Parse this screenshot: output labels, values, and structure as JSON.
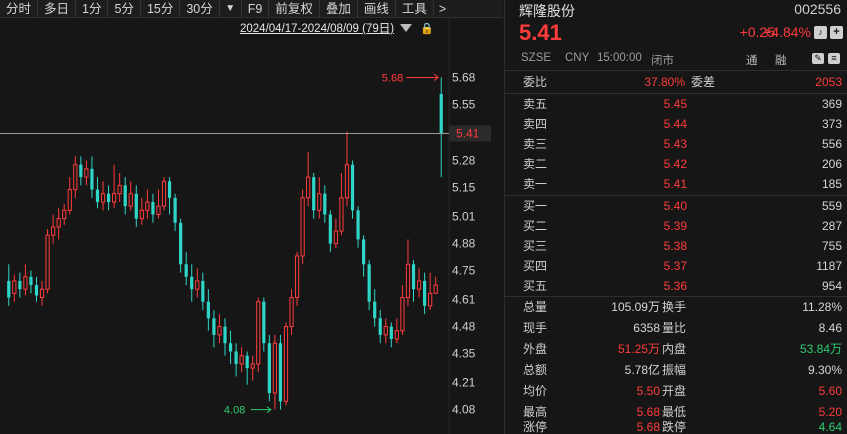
{
  "toolbar": {
    "buttons": [
      "分时",
      "多日",
      "1分",
      "5分",
      "15分",
      "30分",
      "▼",
      "F9",
      "前复权",
      "叠加",
      "画线",
      "工具",
      ">"
    ]
  },
  "chart": {
    "period": "2024/04/17-2024/08/09 (79日)",
    "max_label": "5.68",
    "min_label": "4.08",
    "last_price_tag": "5.41",
    "colors": {
      "up": "#ff3b3b",
      "down": "#2fd6c8",
      "max_label": "#ff3b3b",
      "min_label": "#2ecc71"
    }
  },
  "chart_data": {
    "type": "candlestick",
    "y_ticks": [
      "5.68",
      "5.55",
      "5.41",
      "5.28",
      "5.15",
      "5.01",
      "4.88",
      "4.75",
      "4.61",
      "4.48",
      "4.35",
      "4.21",
      "4.08"
    ],
    "ylim": [
      4.03,
      5.74
    ],
    "candles": [
      {
        "o": 4.7,
        "c": 4.62,
        "h": 4.78,
        "l": 4.58
      },
      {
        "o": 4.64,
        "c": 4.7,
        "h": 4.73,
        "l": 4.6
      },
      {
        "o": 4.7,
        "c": 4.66,
        "h": 4.74,
        "l": 4.62
      },
      {
        "o": 4.66,
        "c": 4.72,
        "h": 4.78,
        "l": 4.63
      },
      {
        "o": 4.72,
        "c": 4.68,
        "h": 4.75,
        "l": 4.64
      },
      {
        "o": 4.68,
        "c": 4.63,
        "h": 4.72,
        "l": 4.6
      },
      {
        "o": 4.62,
        "c": 4.66,
        "h": 4.7,
        "l": 4.58
      },
      {
        "o": 4.66,
        "c": 4.92,
        "h": 4.95,
        "l": 4.64
      },
      {
        "o": 4.92,
        "c": 4.96,
        "h": 5.02,
        "l": 4.88
      },
      {
        "o": 4.96,
        "c": 5.0,
        "h": 5.05,
        "l": 4.9
      },
      {
        "o": 5.0,
        "c": 5.04,
        "h": 5.07,
        "l": 4.97
      },
      {
        "o": 5.04,
        "c": 5.14,
        "h": 5.2,
        "l": 5.02
      },
      {
        "o": 5.14,
        "c": 5.26,
        "h": 5.3,
        "l": 5.1
      },
      {
        "o": 5.26,
        "c": 5.2,
        "h": 5.3,
        "l": 5.16
      },
      {
        "o": 5.2,
        "c": 5.24,
        "h": 5.28,
        "l": 5.16
      },
      {
        "o": 5.24,
        "c": 5.14,
        "h": 5.3,
        "l": 5.1
      },
      {
        "o": 5.14,
        "c": 5.08,
        "h": 5.2,
        "l": 5.05
      },
      {
        "o": 5.08,
        "c": 5.12,
        "h": 5.18,
        "l": 5.04
      },
      {
        "o": 5.12,
        "c": 5.08,
        "h": 5.16,
        "l": 5.04
      },
      {
        "o": 5.08,
        "c": 5.12,
        "h": 5.26,
        "l": 5.05
      },
      {
        "o": 5.12,
        "c": 5.16,
        "h": 5.22,
        "l": 5.08
      },
      {
        "o": 5.16,
        "c": 5.06,
        "h": 5.2,
        "l": 5.02
      },
      {
        "o": 5.06,
        "c": 5.12,
        "h": 5.18,
        "l": 5.04
      },
      {
        "o": 5.12,
        "c": 5.0,
        "h": 5.16,
        "l": 4.96
      },
      {
        "o": 5.0,
        "c": 5.04,
        "h": 5.1,
        "l": 4.97
      },
      {
        "o": 5.04,
        "c": 5.08,
        "h": 5.14,
        "l": 5.0
      },
      {
        "o": 5.08,
        "c": 5.02,
        "h": 5.12,
        "l": 4.98
      },
      {
        "o": 5.02,
        "c": 5.06,
        "h": 5.14,
        "l": 5.0
      },
      {
        "o": 5.06,
        "c": 5.18,
        "h": 5.2,
        "l": 5.04
      },
      {
        "o": 5.18,
        "c": 5.1,
        "h": 5.2,
        "l": 5.02
      },
      {
        "o": 5.1,
        "c": 4.98,
        "h": 5.12,
        "l": 4.94
      },
      {
        "o": 4.98,
        "c": 4.78,
        "h": 5.0,
        "l": 4.74
      },
      {
        "o": 4.78,
        "c": 4.72,
        "h": 4.84,
        "l": 4.68
      },
      {
        "o": 4.72,
        "c": 4.66,
        "h": 4.78,
        "l": 4.6
      },
      {
        "o": 4.66,
        "c": 4.7,
        "h": 4.76,
        "l": 4.62
      },
      {
        "o": 4.7,
        "c": 4.6,
        "h": 4.74,
        "l": 4.56
      },
      {
        "o": 4.6,
        "c": 4.52,
        "h": 4.66,
        "l": 4.46
      },
      {
        "o": 4.52,
        "c": 4.44,
        "h": 4.56,
        "l": 4.38
      },
      {
        "o": 4.44,
        "c": 4.48,
        "h": 4.54,
        "l": 4.4
      },
      {
        "o": 4.48,
        "c": 4.4,
        "h": 4.52,
        "l": 4.34
      },
      {
        "o": 4.4,
        "c": 4.36,
        "h": 4.46,
        "l": 4.3
      },
      {
        "o": 4.36,
        "c": 4.3,
        "h": 4.4,
        "l": 4.24
      },
      {
        "o": 4.3,
        "c": 4.34,
        "h": 4.38,
        "l": 4.26
      },
      {
        "o": 4.34,
        "c": 4.28,
        "h": 4.36,
        "l": 4.2
      },
      {
        "o": 4.28,
        "c": 4.3,
        "h": 4.34,
        "l": 4.22
      },
      {
        "o": 4.3,
        "c": 4.6,
        "h": 4.62,
        "l": 4.26
      },
      {
        "o": 4.6,
        "c": 4.4,
        "h": 4.62,
        "l": 4.36
      },
      {
        "o": 4.4,
        "c": 4.16,
        "h": 4.44,
        "l": 4.12
      },
      {
        "o": 4.16,
        "c": 4.4,
        "h": 4.44,
        "l": 4.08
      },
      {
        "o": 4.4,
        "c": 4.12,
        "h": 4.44,
        "l": 4.08
      },
      {
        "o": 4.12,
        "c": 4.48,
        "h": 4.5,
        "l": 4.1
      },
      {
        "o": 4.48,
        "c": 4.62,
        "h": 4.66,
        "l": 4.44
      },
      {
        "o": 4.62,
        "c": 4.82,
        "h": 4.84,
        "l": 4.58
      },
      {
        "o": 4.82,
        "c": 5.1,
        "h": 5.14,
        "l": 4.78
      },
      {
        "o": 5.1,
        "c": 5.2,
        "h": 5.32,
        "l": 5.06
      },
      {
        "o": 5.2,
        "c": 5.04,
        "h": 5.22,
        "l": 5.0
      },
      {
        "o": 5.04,
        "c": 5.12,
        "h": 5.2,
        "l": 5.0
      },
      {
        "o": 5.12,
        "c": 5.02,
        "h": 5.16,
        "l": 4.98
      },
      {
        "o": 5.02,
        "c": 4.88,
        "h": 5.04,
        "l": 4.84
      },
      {
        "o": 4.88,
        "c": 4.94,
        "h": 5.0,
        "l": 4.86
      },
      {
        "o": 4.94,
        "c": 5.1,
        "h": 5.22,
        "l": 4.92
      },
      {
        "o": 5.1,
        "c": 5.26,
        "h": 5.42,
        "l": 5.06
      },
      {
        "o": 5.26,
        "c": 5.04,
        "h": 5.28,
        "l": 5.0
      },
      {
        "o": 5.04,
        "c": 4.9,
        "h": 5.06,
        "l": 4.86
      },
      {
        "o": 4.9,
        "c": 4.78,
        "h": 4.92,
        "l": 4.72
      },
      {
        "o": 4.78,
        "c": 4.6,
        "h": 4.8,
        "l": 4.56
      },
      {
        "o": 4.6,
        "c": 4.52,
        "h": 4.66,
        "l": 4.48
      },
      {
        "o": 4.52,
        "c": 4.44,
        "h": 4.56,
        "l": 4.4
      },
      {
        "o": 4.44,
        "c": 4.48,
        "h": 4.52,
        "l": 4.4
      },
      {
        "o": 4.48,
        "c": 4.42,
        "h": 4.5,
        "l": 4.38
      },
      {
        "o": 4.42,
        "c": 4.46,
        "h": 4.52,
        "l": 4.4
      },
      {
        "o": 4.46,
        "c": 4.62,
        "h": 4.68,
        "l": 4.44
      },
      {
        "o": 4.62,
        "c": 4.78,
        "h": 4.9,
        "l": 4.58
      },
      {
        "o": 4.78,
        "c": 4.66,
        "h": 4.8,
        "l": 4.6
      },
      {
        "o": 4.66,
        "c": 4.7,
        "h": 4.76,
        "l": 4.62
      },
      {
        "o": 4.7,
        "c": 4.58,
        "h": 4.74,
        "l": 4.54
      },
      {
        "o": 4.58,
        "c": 4.64,
        "h": 4.74,
        "l": 4.56
      },
      {
        "o": 4.64,
        "c": 4.68,
        "h": 4.72,
        "l": 4.64
      },
      {
        "o": 5.6,
        "c": 5.41,
        "h": 5.68,
        "l": 5.2
      }
    ]
  },
  "quote": {
    "name": "辉隆股份",
    "code": "002556",
    "price": "5.41",
    "change": "+0.25",
    "change_pct": "+4.84%",
    "exchange": "SZSE",
    "currency": "CNY",
    "time": "15:00:00",
    "status": "闭市",
    "tong": "通",
    "rong": "融"
  },
  "order_ratio": {
    "label1": "委比",
    "value1": "37.80%",
    "label2": "委差",
    "value2": "2053"
  },
  "asks": [
    {
      "label": "卖五",
      "price": "5.45",
      "vol": "369"
    },
    {
      "label": "卖四",
      "price": "5.44",
      "vol": "373"
    },
    {
      "label": "卖三",
      "price": "5.43",
      "vol": "556"
    },
    {
      "label": "卖二",
      "price": "5.42",
      "vol": "206"
    },
    {
      "label": "卖一",
      "price": "5.41",
      "vol": "185"
    }
  ],
  "bids": [
    {
      "label": "买一",
      "price": "5.40",
      "vol": "559"
    },
    {
      "label": "买二",
      "price": "5.39",
      "vol": "287"
    },
    {
      "label": "买三",
      "price": "5.38",
      "vol": "755"
    },
    {
      "label": "买四",
      "price": "5.37",
      "vol": "1187"
    },
    {
      "label": "买五",
      "price": "5.36",
      "vol": "954"
    }
  ],
  "stats": [
    {
      "l1": "总量",
      "v1": "105.09万",
      "c1": "",
      "l2": "换手",
      "v2": "11.28%",
      "c2": ""
    },
    {
      "l1": "现手",
      "v1": "6358",
      "c1": "",
      "l2": "量比",
      "v2": "8.46",
      "c2": ""
    },
    {
      "l1": "外盘",
      "v1": "51.25万",
      "c1": "red",
      "l2": "内盘",
      "v2": "53.84万",
      "c2": "green"
    },
    {
      "l1": "总额",
      "v1": "5.78亿",
      "c1": "",
      "l2": "振幅",
      "v2": "9.30%",
      "c2": ""
    },
    {
      "l1": "均价",
      "v1": "5.50",
      "c1": "red",
      "l2": "开盘",
      "v2": "5.60",
      "c2": "red"
    },
    {
      "l1": "最高",
      "v1": "5.68",
      "c1": "red",
      "l2": "最低",
      "v2": "5.20",
      "c2": "red"
    },
    {
      "l1": "涨停",
      "v1": "5.68",
      "c1": "red",
      "l2": "跌停",
      "v2": "4.64",
      "c2": "green"
    }
  ]
}
